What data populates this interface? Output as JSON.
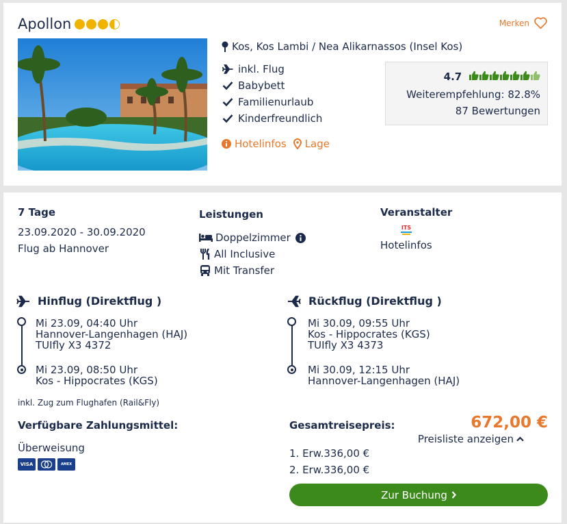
{
  "hotel": {
    "name": "Apollon",
    "stars": 3.5,
    "merken_label": "Merken",
    "location": "Kos, Kos Lambi / Nea Alikarnassos (Insel Kos)",
    "features": [
      "inkl. Flug",
      "Babybett",
      "Familienurlaub",
      "Kinderfreundlich"
    ],
    "links": {
      "infos": "Hotelinfos",
      "lage": "Lage"
    },
    "rating": {
      "score": "4.7",
      "thumbs_filled": 6.5,
      "thumbs_total": 7,
      "recommendation": "Weiterempfehlung: 82.8%",
      "reviews": "87 Bewertungen"
    }
  },
  "trip": {
    "duration": "7 Tage",
    "dates": "23.09.2020 - 30.09.2020",
    "departure": "Flug ab Hannover",
    "services_title": "Leistungen",
    "services": [
      "Doppelzimmer",
      "All Inclusive",
      "Mit Transfer"
    ],
    "operator_title": "Veranstalter",
    "operator_logo": "ITS",
    "operator_link": "Hotelinfos"
  },
  "outbound": {
    "title": "Hinflug (Direktflug )",
    "dep_time": "Mi 23.09, 04:40 Uhr",
    "dep_airport": "Hannover-Langenhagen (HAJ)",
    "flight_no": "TUIfly X3 4372",
    "arr_time": "Mi 23.09, 08:50 Uhr",
    "arr_airport": "Kos - Hippocrates (KGS)"
  },
  "return": {
    "title": "Rückflug (Direktflug )",
    "dep_time": "Mi 30.09, 09:55 Uhr",
    "dep_airport": "Kos - Hippocrates (KGS)",
    "flight_no": "TUIfly X3 4373",
    "arr_time": "Mi 30.09, 12:15 Uhr",
    "arr_airport": "Hannover-Langenhagen (HAJ)"
  },
  "rail_note": "inkl. Zug zum Flughafen (Rail&Fly)",
  "payment": {
    "title": "Verfügbare Zahlungsmittel:",
    "method": "Überweisung",
    "cards": [
      "VISA",
      "Mastercard",
      "American Express"
    ]
  },
  "price": {
    "title": "Gesamtreisepreis:",
    "total": "672,00 €",
    "list_toggle": "Preisliste anzeigen",
    "items": [
      "1. Erw.336,00 €",
      "2. Erw.336,00 €"
    ]
  },
  "booking_button": "Zur Buchung",
  "colors": {
    "accent": "#e8782b",
    "navy": "#1c2a4a",
    "green": "#3c8a1c",
    "star": "#f0b400"
  }
}
